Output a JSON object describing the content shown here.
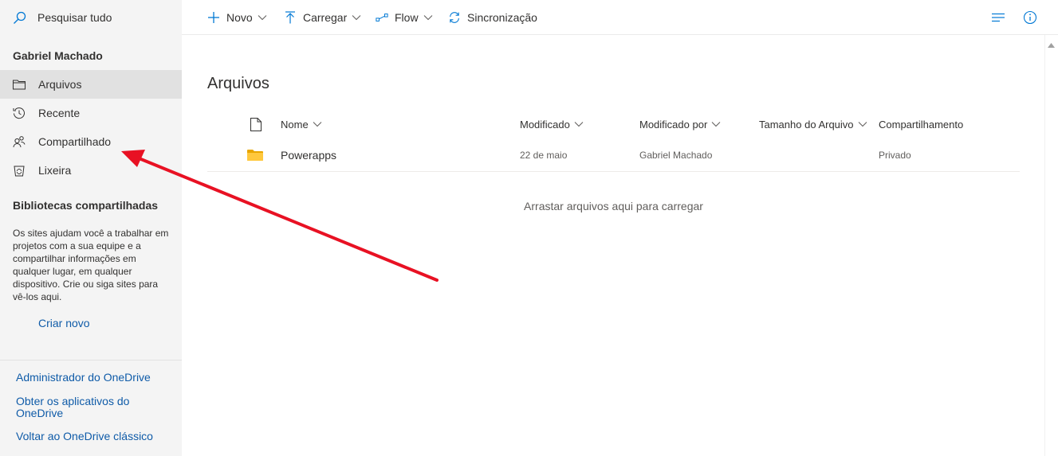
{
  "sidebar": {
    "search_label": "Pesquisar tudo",
    "user_name": "Gabriel Machado",
    "nav": [
      {
        "label": "Arquivos",
        "icon": "folder-icon",
        "active": true
      },
      {
        "label": "Recente",
        "icon": "history-icon"
      },
      {
        "label": "Compartilhado",
        "icon": "people-icon"
      },
      {
        "label": "Lixeira",
        "icon": "recycle-bin-icon"
      }
    ],
    "libraries_title": "Bibliotecas compartilhadas",
    "libraries_desc": "Os sites ajudam você a trabalhar em projetos com a sua equipe e a compartilhar informações em qualquer lugar, em qualquer dispositivo. Crie ou siga sites para vê-los aqui.",
    "create_new": "Criar novo",
    "links": [
      "Administrador do OneDrive",
      "Obter os aplicativos do OneDrive",
      "Voltar ao OneDrive clássico"
    ]
  },
  "toolbar": {
    "new_label": "Novo",
    "upload_label": "Carregar",
    "flow_label": "Flow",
    "sync_label": "Sincronização"
  },
  "main": {
    "title": "Arquivos",
    "columns": {
      "name": "Nome",
      "modified": "Modificado",
      "modified_by": "Modificado por",
      "size": "Tamanho do Arquivo",
      "sharing": "Compartilhamento"
    },
    "rows": [
      {
        "name": "Powerapps",
        "modified": "22 de maio",
        "modified_by": "Gabriel Machado",
        "size": "",
        "sharing": "Privado"
      }
    ],
    "drop_hint": "Arrastar arquivos aqui para carregar"
  },
  "colors": {
    "accent": "#0078d4",
    "link": "#0f5ba8",
    "folder": "#ffb900",
    "annotation_arrow": "#e81123",
    "sidebar_bg": "#f4f4f4"
  }
}
